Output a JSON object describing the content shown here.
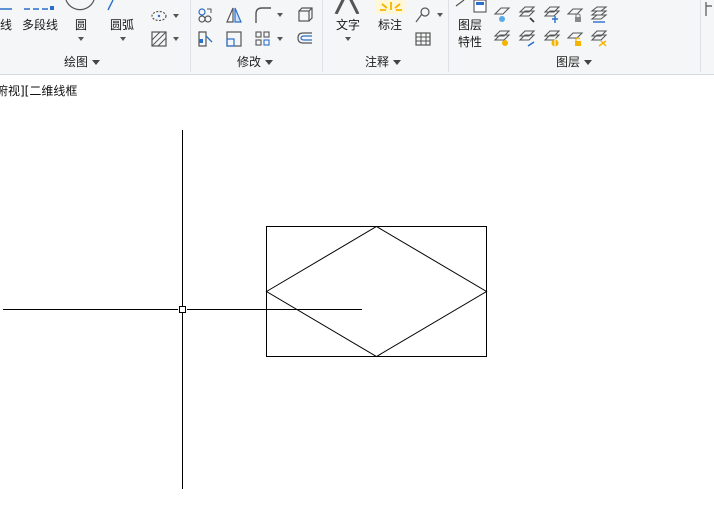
{
  "ribbon": {
    "draw_panel": {
      "title": "绘图",
      "items": [
        "线",
        "多段线",
        "圆",
        "圆弧"
      ]
    },
    "modify_panel": {
      "title": "修改"
    },
    "annotation_panel": {
      "title": "注释",
      "items": [
        "文字",
        "标注"
      ]
    },
    "layers_panel": {
      "title": "图层",
      "layer_properties_line1": "图层",
      "layer_properties_line2": "特性"
    },
    "accent_color": "#1e7bd6",
    "warning_color": "#f4b400"
  },
  "viewport": {
    "label": "俯视][二维线框"
  }
}
